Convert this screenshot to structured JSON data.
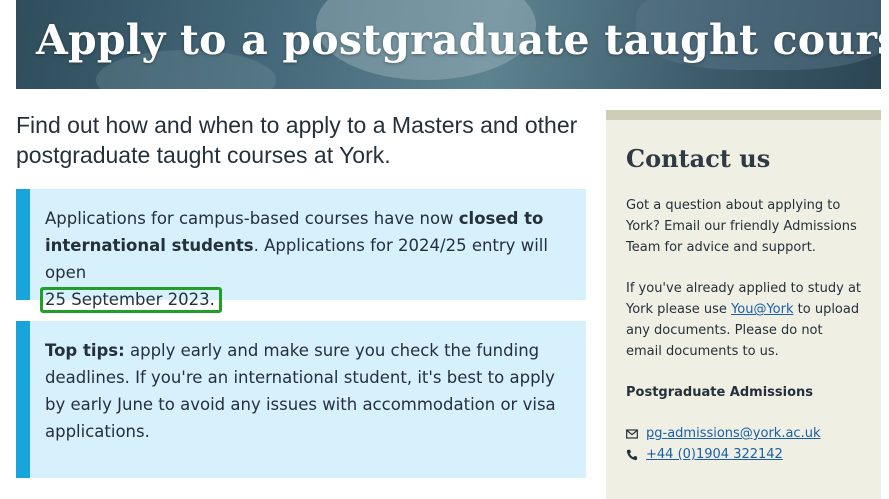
{
  "hero": {
    "title": "Apply to a postgraduate taught course"
  },
  "lead": "Find out how and when to apply to a Masters and other postgraduate taught courses at York.",
  "notice_closed": {
    "text_before": "Applications for campus-based courses have now ",
    "bold": "closed to international students",
    "text_after": ". Applications for 2024/25 entry will open ",
    "date": "25 September 2023."
  },
  "notice_tips": {
    "bold": "Top tips:",
    "text": " apply early and make sure you check the funding deadlines. If you're an international student, it's best to apply by early June to avoid any issues with accommodation or visa applications."
  },
  "sidebar": {
    "title": "Contact us",
    "intro": "Got a question about applying to York? Email our friendly Admissions Team for advice and support.",
    "applied_before": "If you've already applied to study at York please use ",
    "applied_link": "You@York",
    "applied_after": " to upload any documents. Please do not email documents to us.",
    "subhead": "Postgraduate Admissions",
    "email": "pg-admissions@york.ac.uk",
    "phone": "+44 (0)1904 322142"
  },
  "colors": {
    "accent": "#1aa4dc",
    "notice_bg": "#d6f1fc",
    "highlight": "#1f9e2a",
    "sidebar_bg": "#efefe4"
  }
}
